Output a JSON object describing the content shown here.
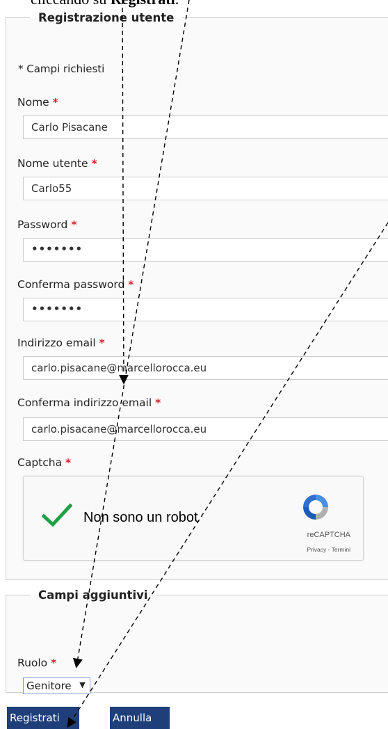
{
  "caption": {
    "prefix": "cliccando su ",
    "bold": "Registrati",
    "suffix": "."
  },
  "registration": {
    "legend": "Registrazione utente",
    "required_note": "* Campi richiesti",
    "required_mark": "*",
    "fields": {
      "name": {
        "label": "Nome",
        "value": "Carlo Pisacane"
      },
      "username": {
        "label": "Nome utente",
        "value": "Carlo55"
      },
      "password": {
        "label": "Password",
        "value": "•••••••"
      },
      "password_confirm": {
        "label": "Conferma password",
        "value": "•••••••"
      },
      "email": {
        "label": "Indirizzo email",
        "value": "carlo.pisacane@marcellorocca.eu"
      },
      "email_confirm": {
        "label": "Conferma indirizzo email",
        "value": "carlo.pisacane@marcellorocca.eu"
      }
    },
    "captcha": {
      "label": "Captcha",
      "text": "Non sono un robot",
      "brand": "reCAPTCHA",
      "links": "Privacy - Termini"
    }
  },
  "additional": {
    "legend": "Campi aggiuntivi",
    "role": {
      "label": "Ruolo",
      "value": "Genitore"
    }
  },
  "buttons": {
    "register": "Registrati",
    "cancel": "Annulla"
  },
  "colors": {
    "required": "#d9232d",
    "button_bg": "#1e3f7a",
    "check": "#1fa045"
  },
  "icons": {
    "checkmark": "checkmark-icon",
    "recaptcha": "recaptcha-logo-icon",
    "dropdown": "chevron-down-icon"
  }
}
